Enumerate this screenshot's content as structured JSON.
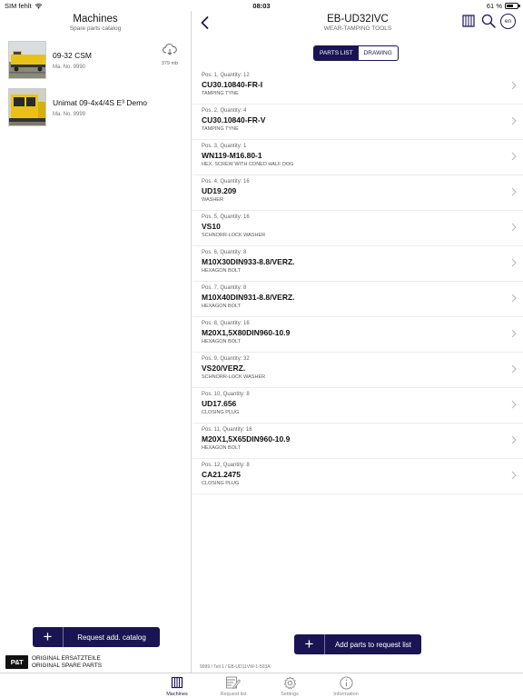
{
  "status_bar": {
    "carrier": "SIM fehlt",
    "time": "08:03",
    "battery": "61 %",
    "battery_level": 0.61
  },
  "left_panel": {
    "title": "Machines",
    "subtitle": "Spare parts catalog",
    "machines": [
      {
        "name": "09-32 CSM",
        "ma_no": "Ma. No. 9990",
        "download_size": "379 mb"
      },
      {
        "name": "Unimat 09-4x4/4S E³ Demo",
        "ma_no": "Ma. No. 9999"
      }
    ],
    "request_catalog_label": "Request add. catalog",
    "brand": {
      "logo": "P&T",
      "line1": "ORIGINAL ERSATZTEILE",
      "line2": "ORIGINAL SPARE PARTS"
    }
  },
  "right_panel": {
    "title": "EB-UD32IVC",
    "subtitle": "WEAR-TAMPING TOOLS",
    "language": "en",
    "segments": [
      "PARTS LIST",
      "DRAWING"
    ],
    "active_segment": "PARTS LIST",
    "parts": [
      {
        "pos": "Pos. 1, Quantity: 12",
        "number": "CU30.10840-FR-I",
        "desc": "TAMPING TYNE"
      },
      {
        "pos": "Pos. 2, Quantity: 4",
        "number": "CU30.10840-FR-V",
        "desc": "TAMPING TYNE"
      },
      {
        "pos": "Pos. 3, Quantity: 1",
        "number": "WN119-M16.80-1",
        "desc": "HEX. SCREW WITH CONED HALF DOG"
      },
      {
        "pos": "Pos. 4, Quantity: 16",
        "number": "UD19.209",
        "desc": "WASHER"
      },
      {
        "pos": "Pos. 5, Quantity: 16",
        "number": "VS10",
        "desc": "SCHNORR-LOCK WASHER"
      },
      {
        "pos": "Pos. 6, Quantity: 8",
        "number": "M10X30DIN933-8.8/VERZ.",
        "desc": "HEXAGON BOLT"
      },
      {
        "pos": "Pos. 7, Quantity: 8",
        "number": "M10X40DIN931-8.8/VERZ.",
        "desc": "HEXAGON BOLT"
      },
      {
        "pos": "Pos. 8, Quantity: 16",
        "number": "M20X1,5X80DIN960-10.9",
        "desc": "HEXAGON BOLT"
      },
      {
        "pos": "Pos. 9, Quantity: 32",
        "number": "VS20/VERZ.",
        "desc": "SCHNORR-LOCK WASHER"
      },
      {
        "pos": "Pos. 10, Quantity: 8",
        "number": "UD17.656",
        "desc": "CLOSING PLUG"
      },
      {
        "pos": "Pos. 11, Quantity: 16",
        "number": "M20X1,5X65DIN960-10.9",
        "desc": "HEXAGON BOLT"
      },
      {
        "pos": "Pos. 12, Quantity: 8",
        "number": "CA21.2475",
        "desc": "CLOSING PLUG"
      }
    ],
    "add_parts_label": "Add parts to request list",
    "footnote": "9999 / Teil 1 / EB-UD11VW-1-503A"
  },
  "tab_bar": {
    "tabs": [
      {
        "label": "Machines",
        "icon": "book-icon"
      },
      {
        "label": "Request list",
        "icon": "edit-list-icon"
      },
      {
        "label": "Settings",
        "icon": "gear-icon"
      },
      {
        "label": "Information",
        "icon": "info-icon"
      }
    ],
    "active": "Machines"
  },
  "colors": {
    "accent": "#1a1552",
    "divider": "#d4d4d4",
    "muted_text": "#666666"
  }
}
